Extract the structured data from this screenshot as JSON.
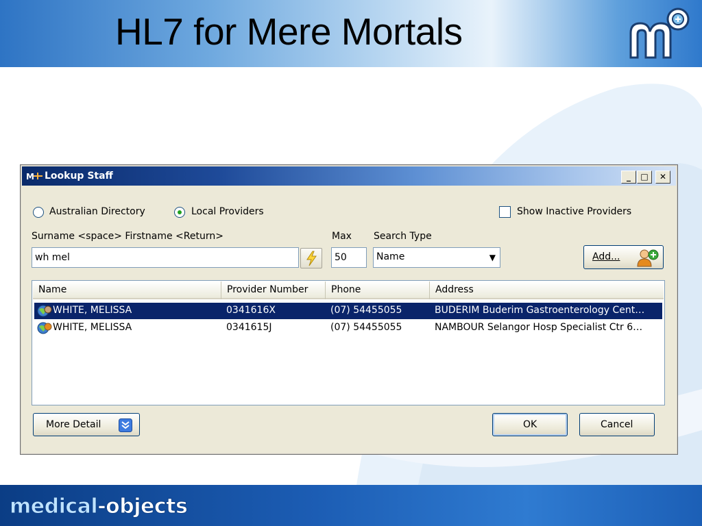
{
  "slide": {
    "title": "HL7 for Mere Mortals",
    "footer_brand_part1": "medical",
    "footer_brand_part2": "-objects"
  },
  "dialog": {
    "title": "Lookup Staff",
    "titlebar_buttons": {
      "minimize": "_",
      "maximize": "□",
      "close": "✕"
    },
    "radio_australian_directory": "Australian Directory",
    "radio_local_providers": "Local Providers",
    "selected_source": "Local Providers",
    "show_inactive_label": "Show Inactive Providers",
    "show_inactive_checked": false,
    "search_label": "Surname <space> Firstname <Return>",
    "search_value": "wh mel",
    "max_label": "Max",
    "max_value": "50",
    "search_type_label": "Search Type",
    "search_type_value": "Name",
    "add_button": "Add...",
    "columns": [
      "Name",
      "Provider Number",
      "Phone",
      "Address"
    ],
    "rows": [
      {
        "name": "WHITE, MELISSA",
        "provider_number": "0341616X",
        "phone": "(07) 54455055",
        "address": "BUDERIM Buderim Gastroenterology Cent…",
        "selected": true
      },
      {
        "name": "WHITE, MELISSA",
        "provider_number": "0341615J",
        "phone": "(07) 54455055",
        "address": "NAMBOUR Selangor Hosp Specialist Ctr 6…",
        "selected": false
      }
    ],
    "more_detail_button": "More Detail",
    "ok_button": "OK",
    "cancel_button": "Cancel"
  },
  "colors": {
    "selection": "#0a246a",
    "titlebar_dark": "#0a2a6a",
    "radio_dot": "#21a121"
  }
}
